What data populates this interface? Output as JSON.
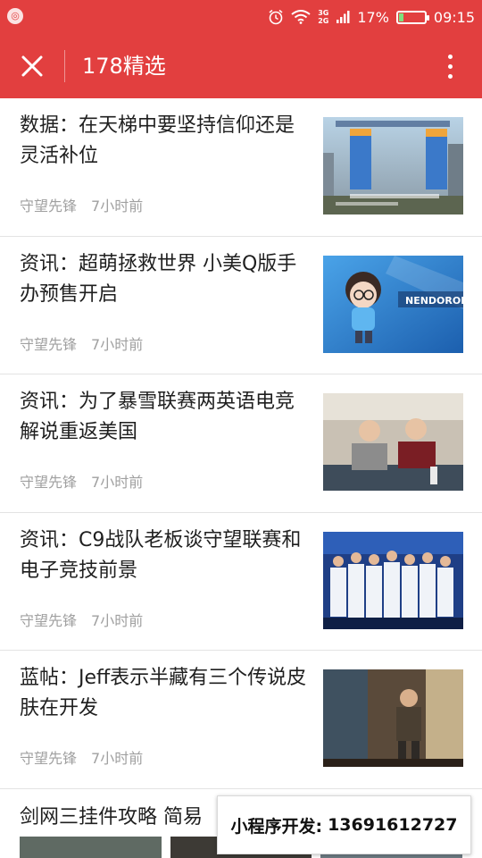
{
  "status_bar": {
    "app_icon": "notification-icon",
    "alarm_icon": "alarm-icon",
    "wifi_icon": "wifi-icon",
    "network_top": "3G",
    "network_bottom": "2G",
    "signal_icon": "signal-icon",
    "battery_percent": "17%",
    "battery_level": 0.17,
    "time": "09:15"
  },
  "app_bar": {
    "close_icon": "close-icon",
    "title": "178精选",
    "more_icon": "more-vert-icon",
    "accent_color": "#e23f3f"
  },
  "articles": [
    {
      "title": "数据：在天梯中要坚持信仰还是灵活补位",
      "source": "守望先锋",
      "time": "7小时前",
      "image": "chart-bars-thumbnail"
    },
    {
      "title": "资讯：超萌拯救世界 小美Q版手办预售开启",
      "source": "守望先锋",
      "time": "7小时前",
      "image": "nendoroid-mei-thumbnail"
    },
    {
      "title": "资讯：为了暴雪联赛两英语电竞解说重返美国",
      "source": "守望先锋",
      "time": "7小时前",
      "image": "casters-thumbnail"
    },
    {
      "title": "资讯：C9战队老板谈守望联赛和电子竞技前景",
      "source": "守望先锋",
      "time": "7小时前",
      "image": "team-photo-thumbnail"
    },
    {
      "title": "蓝帖：Jeff表示半藏有三个传说皮肤在开发",
      "source": "守望先锋",
      "time": "7小时前",
      "image": "hanzo-skin-thumbnail"
    }
  ],
  "partial_article": {
    "title": "剑网三挂件攻略 简易"
  },
  "promo": {
    "label": "小程序开发:",
    "phone": "13691612727"
  }
}
